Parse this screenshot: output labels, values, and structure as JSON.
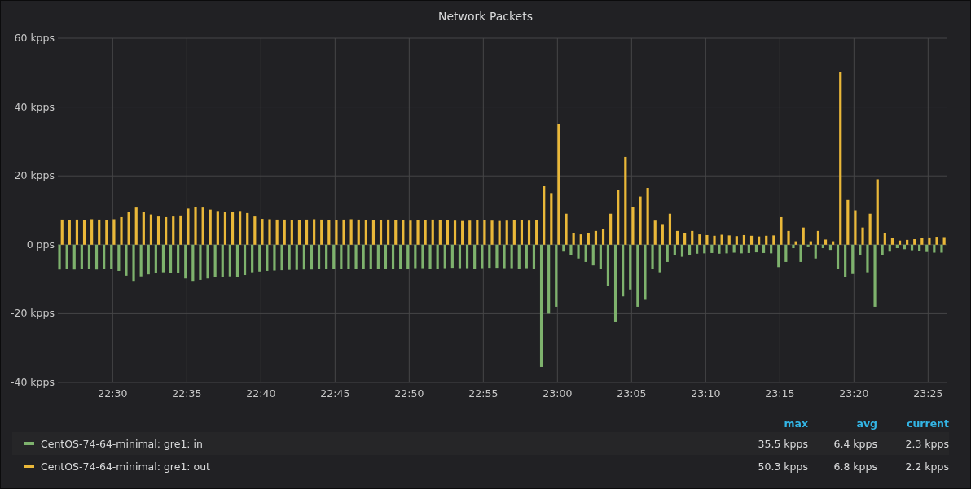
{
  "panel": {
    "title": "Network Packets"
  },
  "chart_data": {
    "type": "bar",
    "stacked": false,
    "categories": [
      null,
      null,
      null,
      null,
      null,
      null,
      null,
      "22:30",
      null,
      null,
      null,
      null,
      null,
      null,
      null,
      null,
      null,
      "22:35",
      null,
      null,
      null,
      null,
      null,
      null,
      null,
      null,
      null,
      "22:40",
      null,
      null,
      null,
      null,
      null,
      null,
      null,
      null,
      null,
      "22:45",
      null,
      null,
      null,
      null,
      null,
      null,
      null,
      null,
      null,
      "22:50",
      null,
      null,
      null,
      null,
      null,
      null,
      null,
      null,
      null,
      "22:55",
      null,
      null,
      null,
      null,
      null,
      null,
      null,
      null,
      null,
      "23:00",
      null,
      null,
      null,
      null,
      null,
      null,
      null,
      null,
      null,
      "23:05",
      null,
      null,
      null,
      null,
      null,
      null,
      null,
      null,
      null,
      "23:10",
      null,
      null,
      null,
      null,
      null,
      null,
      null,
      null,
      null,
      "23:15",
      null,
      null,
      null,
      null,
      null,
      null,
      null,
      null,
      null,
      "23:20",
      null,
      null,
      null,
      null,
      null,
      null,
      null,
      null,
      null,
      "23:25",
      null,
      null
    ],
    "series": [
      {
        "name": "CentOS-74-64-minimal: gre1: in",
        "color": "#7eb26d",
        "values": [
          -7.2,
          -7.1,
          -7.2,
          -7.0,
          -7.1,
          -7.2,
          -7.0,
          -7.1,
          -7.6,
          -9.0,
          -10.5,
          -9.2,
          -8.6,
          -8.2,
          -8.0,
          -8.1,
          -8.3,
          -9.8,
          -10.5,
          -10.2,
          -9.8,
          -9.5,
          -9.3,
          -9.2,
          -9.4,
          -8.8,
          -8.0,
          -7.8,
          -7.6,
          -7.5,
          -7.4,
          -7.3,
          -7.3,
          -7.2,
          -7.2,
          -7.1,
          -7.1,
          -7.0,
          -7.0,
          -7.0,
          -7.1,
          -7.1,
          -7.0,
          -6.9,
          -6.9,
          -7.0,
          -7.0,
          -6.9,
          -6.8,
          -6.8,
          -6.9,
          -6.9,
          -6.8,
          -6.7,
          -6.8,
          -6.8,
          -6.9,
          -6.8,
          -6.7,
          -6.7,
          -6.8,
          -6.8,
          -6.9,
          -6.8,
          -6.9,
          -35.5,
          -20,
          -18,
          -2,
          -3,
          -4,
          -5,
          -6,
          -7,
          -12,
          -22.5,
          -15,
          -13,
          -18,
          -16,
          -7,
          -8,
          -5,
          -3,
          -3.5,
          -3,
          -2.6,
          -2.5,
          -2.4,
          -2.6,
          -2.5,
          -2.3,
          -2.5,
          -2.4,
          -2.2,
          -2.4,
          -2.5,
          -6.5,
          -5,
          -1,
          -5,
          -0.5,
          -4,
          -1,
          -1.5,
          -7,
          -9.5,
          -8.5,
          -3,
          -8,
          -18,
          -3,
          -2,
          -1,
          -1.3,
          -1.6,
          -1.9,
          -2.1,
          -2.3,
          -2.3
        ]
      },
      {
        "name": "CentOS-74-64-minimal: gre1: out",
        "color": "#eab839",
        "values": [
          7.3,
          7.2,
          7.3,
          7.2,
          7.4,
          7.3,
          7.2,
          7.4,
          8,
          9.5,
          10.8,
          9.5,
          8.8,
          8.2,
          8.0,
          8.2,
          8.5,
          10.5,
          11.0,
          10.8,
          10.2,
          9.8,
          9.6,
          9.5,
          9.8,
          9.2,
          8.2,
          7.5,
          7.4,
          7.3,
          7.3,
          7.2,
          7.2,
          7.3,
          7.4,
          7.3,
          7.2,
          7.2,
          7.3,
          7.4,
          7.3,
          7.2,
          7.1,
          7.2,
          7.3,
          7.2,
          7.1,
          7.0,
          7.1,
          7.2,
          7.3,
          7.2,
          7.1,
          7.0,
          6.9,
          7.0,
          7.1,
          7.2,
          7.0,
          6.9,
          7.0,
          7.1,
          7.2,
          7.0,
          7.1,
          17,
          15,
          35,
          9,
          3.5,
          3,
          3.5,
          4,
          4.5,
          9,
          16,
          25.5,
          11,
          14,
          16.5,
          7,
          6,
          9,
          4,
          3.5,
          4,
          3,
          2.8,
          2.6,
          2.9,
          2.7,
          2.5,
          2.8,
          2.6,
          2.4,
          2.6,
          2.7,
          8,
          4,
          1,
          5,
          1,
          4,
          1.5,
          1,
          50.3,
          13,
          10,
          5,
          9,
          19,
          3.5,
          2,
          1.2,
          1.4,
          1.6,
          1.9,
          2.1,
          2.3,
          2.2
        ]
      }
    ],
    "ylim": [
      -40,
      60
    ],
    "grid": true,
    "yticks": [
      {
        "value": 60,
        "label": "60 kpps"
      },
      {
        "value": 40,
        "label": "40 kpps"
      },
      {
        "value": 20,
        "label": "20 kpps"
      },
      {
        "value": 0,
        "label": "0 pps"
      },
      {
        "value": -20,
        "label": "-20 kpps"
      },
      {
        "value": -40,
        "label": "-40 kpps"
      }
    ]
  },
  "legend": {
    "columns": [
      "max",
      "avg",
      "current"
    ],
    "rows": [
      {
        "max": "35.5 kpps",
        "avg": "6.4 kpps",
        "current": "2.3 kpps"
      },
      {
        "max": "50.3 kpps",
        "avg": "6.8 kpps",
        "current": "2.2 kpps"
      }
    ]
  }
}
